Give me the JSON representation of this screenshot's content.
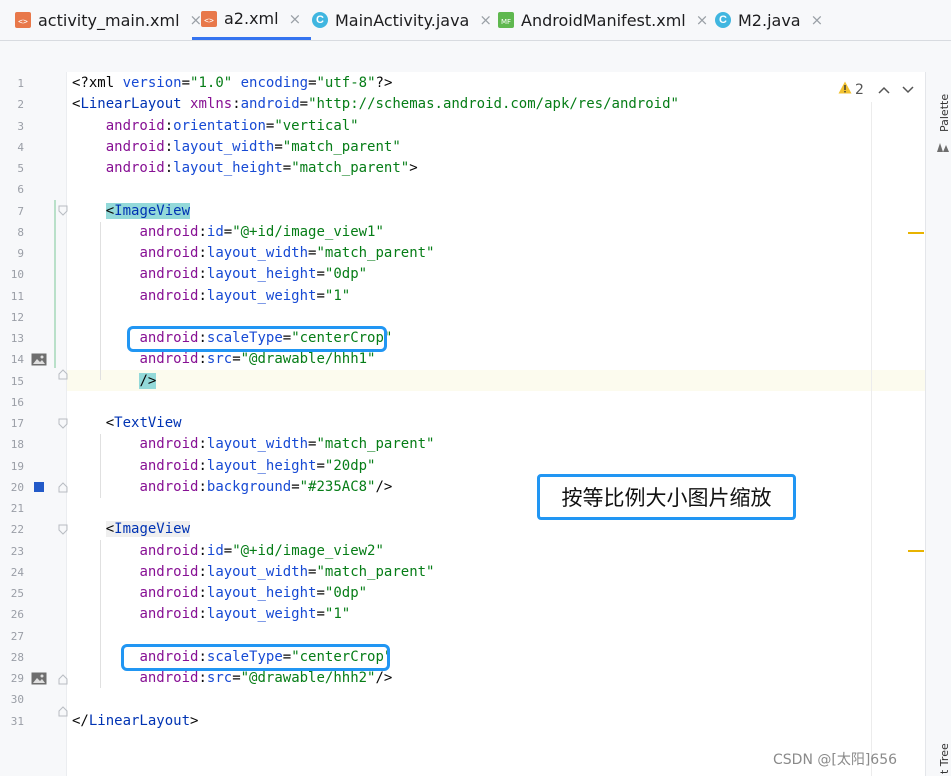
{
  "tabs": [
    {
      "label": "activity_main.xml",
      "icon": "xml-file-icon",
      "active": false
    },
    {
      "label": "a2.xml",
      "icon": "xml-file-icon",
      "active": true
    },
    {
      "label": "MainActivity.java",
      "icon": "java-class-icon",
      "active": false
    },
    {
      "label": "AndroidManifest.xml",
      "icon": "manifest-file-icon",
      "active": false
    },
    {
      "label": "M2.java",
      "icon": "java-class-icon",
      "active": false
    }
  ],
  "tab_close_glyph": "×",
  "inspection": {
    "count": "2"
  },
  "right_panel": {
    "palette_label": "Palette",
    "tree_label": "t Tree"
  },
  "callout_text": "按等比例大小图片缩放",
  "watermark": "CSDN @[太阳]656",
  "lines": [
    {
      "n": "1",
      "text": "<?xml version=\"1.0\" encoding=\"utf-8\"?>"
    },
    {
      "n": "2",
      "text": "<LinearLayout xmlns:android=\"http://schemas.android.com/apk/res/android\""
    },
    {
      "n": "3",
      "text": "    android:orientation=\"vertical\""
    },
    {
      "n": "4",
      "text": "    android:layout_width=\"match_parent\""
    },
    {
      "n": "5",
      "text": "    android:layout_height=\"match_parent\">"
    },
    {
      "n": "6",
      "text": ""
    },
    {
      "n": "7",
      "text": "    <ImageView"
    },
    {
      "n": "8",
      "text": "        android:id=\"@+id/image_view1\""
    },
    {
      "n": "9",
      "text": "        android:layout_width=\"match_parent\""
    },
    {
      "n": "10",
      "text": "        android:layout_height=\"0dp\""
    },
    {
      "n": "11",
      "text": "        android:layout_weight=\"1\""
    },
    {
      "n": "12",
      "text": ""
    },
    {
      "n": "13",
      "text": "        android:scaleType=\"centerCrop\""
    },
    {
      "n": "14",
      "text": "        android:src=\"@drawable/hhh1\""
    },
    {
      "n": "15",
      "text": "        />"
    },
    {
      "n": "16",
      "text": ""
    },
    {
      "n": "17",
      "text": "    <TextView"
    },
    {
      "n": "18",
      "text": "        android:layout_width=\"match_parent\""
    },
    {
      "n": "19",
      "text": "        android:layout_height=\"20dp\""
    },
    {
      "n": "20",
      "text": "        android:background=\"#235AC8\"/>"
    },
    {
      "n": "21",
      "text": ""
    },
    {
      "n": "22",
      "text": "    <ImageView"
    },
    {
      "n": "23",
      "text": "        android:id=\"@+id/image_view2\""
    },
    {
      "n": "24",
      "text": "        android:layout_width=\"match_parent\""
    },
    {
      "n": "25",
      "text": "        android:layout_height=\"0dp\""
    },
    {
      "n": "26",
      "text": "        android:layout_weight=\"1\""
    },
    {
      "n": "27",
      "text": ""
    },
    {
      "n": "28",
      "text": "        android:scaleType=\"centerCrop\""
    },
    {
      "n": "29",
      "text": "        android:src=\"@drawable/hhh2\"/>"
    },
    {
      "n": "30",
      "text": ""
    },
    {
      "n": "31",
      "text": "</LinearLayout>"
    }
  ],
  "colors": {
    "tag": "#0033b3",
    "namespace": "#871094",
    "attribute": "#174ad4",
    "value": "#067d17",
    "highlight_box": "#2196f3",
    "swatch": "#235AC8"
  }
}
